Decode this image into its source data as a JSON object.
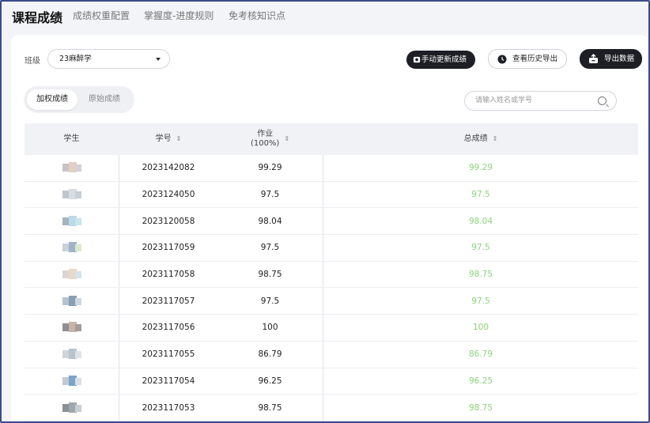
{
  "tabs": [
    {
      "label": "课程成绩",
      "active": true
    },
    {
      "label": "成绩权重配置",
      "active": false
    },
    {
      "label": "掌握度-进度规则",
      "active": false
    },
    {
      "label": "免考核知识点",
      "active": false
    }
  ],
  "filter": {
    "class_label": "班级",
    "class_value": "23麻醉学"
  },
  "actions": {
    "update_label": "手动更新成绩",
    "history_label": "查看历史导出",
    "export_label": "导出数据"
  },
  "score_toggle": {
    "weighted_label": "加权成绩",
    "raw_label": "原始成绩"
  },
  "search": {
    "placeholder": "请输入姓名或学号"
  },
  "table": {
    "headers": {
      "student": "学生",
      "student_id": "学号",
      "homework_line1": "作业",
      "homework_line2": "(100%)",
      "total": "总成绩",
      "sort_glyph": "⇕"
    },
    "rows": [
      {
        "id": "2023142082",
        "homework": "99.29",
        "total": "99.29"
      },
      {
        "id": "2023124050",
        "homework": "97.5",
        "total": "97.5"
      },
      {
        "id": "2023120058",
        "homework": "98.04",
        "total": "98.04"
      },
      {
        "id": "2023117059",
        "homework": "97.5",
        "total": "97.5"
      },
      {
        "id": "2023117058",
        "homework": "98.75",
        "total": "98.75"
      },
      {
        "id": "2023117057",
        "homework": "97.5",
        "total": "97.5"
      },
      {
        "id": "2023117056",
        "homework": "100",
        "total": "100"
      },
      {
        "id": "2023117055",
        "homework": "86.79",
        "total": "86.79"
      },
      {
        "id": "2023117054",
        "homework": "96.25",
        "total": "96.25"
      },
      {
        "id": "2023117053",
        "homework": "98.75",
        "total": "98.75"
      }
    ]
  },
  "colors": {
    "total_score": "#8bd47a",
    "active_highlight": "#d6f25a",
    "dark_button": "#1d1f24"
  }
}
